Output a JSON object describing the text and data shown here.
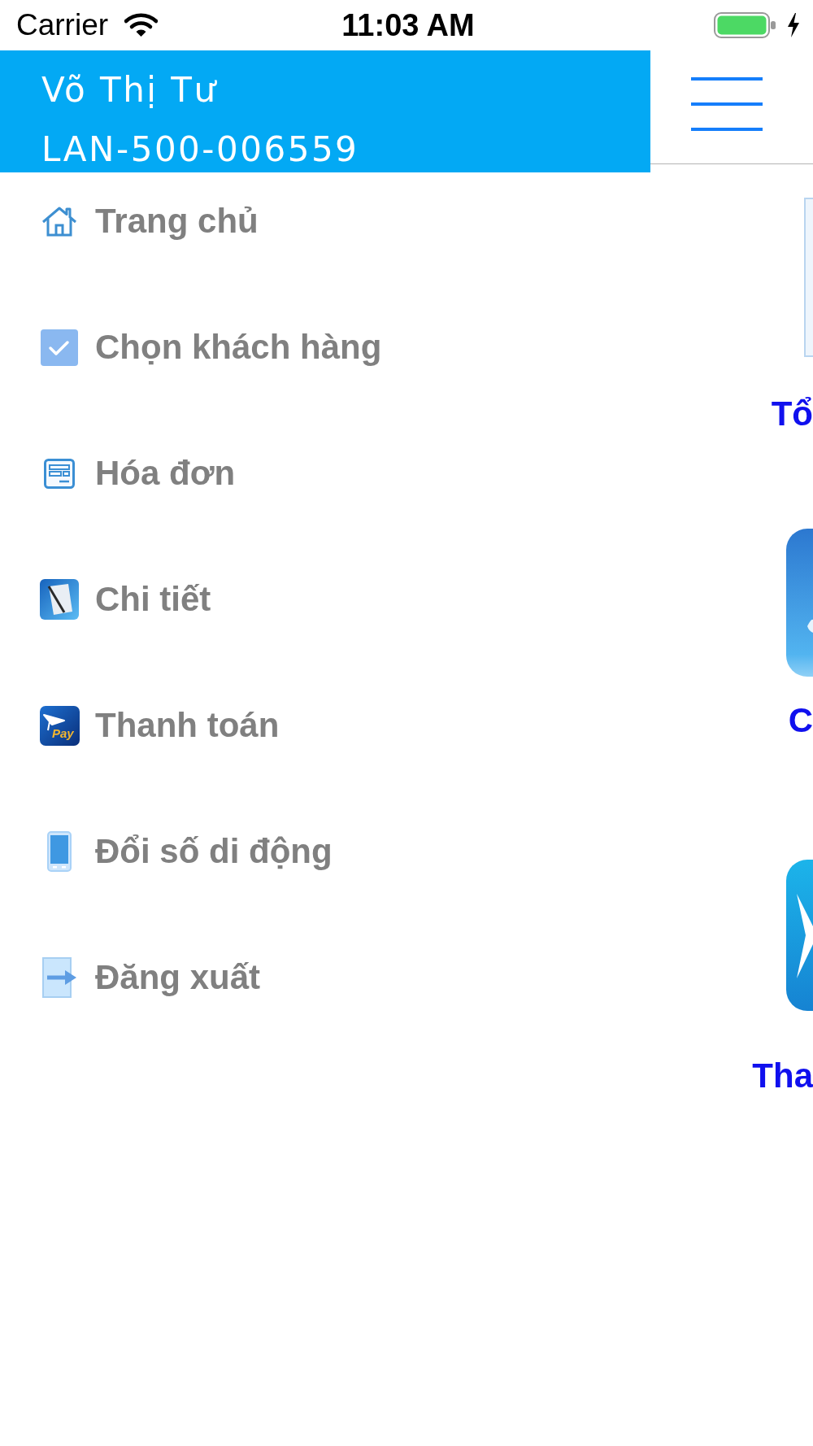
{
  "status_bar": {
    "carrier": "Carrier",
    "time": "11:03 AM"
  },
  "drawer": {
    "header": {
      "name": "Võ Thị Tư",
      "account": "LAN-500-006559"
    },
    "items": [
      {
        "kind": "home",
        "label": "Trang chủ"
      },
      {
        "kind": "check",
        "label": "Chọn khách hàng"
      },
      {
        "kind": "invoice",
        "label": "Hóa đơn"
      },
      {
        "kind": "detail",
        "label": "Chi tiết"
      },
      {
        "kind": "payment",
        "label": "Thanh toán",
        "icon_text": "Pay"
      },
      {
        "kind": "phone",
        "label": "Đổi số di động"
      },
      {
        "kind": "logout",
        "label": "Đăng xuất"
      }
    ]
  },
  "main": {
    "tiles": [
      {
        "kind": "frame",
        "caption": "Tổ"
      },
      {
        "kind": "app",
        "caption": "C"
      },
      {
        "kind": "star",
        "caption": "Tha"
      }
    ]
  }
}
